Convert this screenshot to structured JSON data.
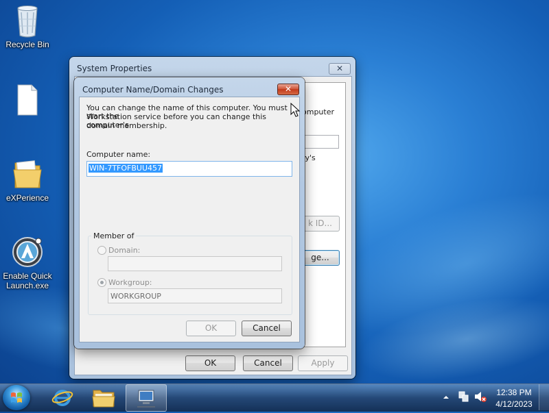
{
  "desktop": {
    "icons": [
      {
        "label": "Recycle Bin",
        "icon": "recycle-bin-icon"
      },
      {
        "label": "",
        "icon": "blank-file-icon"
      },
      {
        "label": "eXPerience",
        "icon": "folder-icon"
      },
      {
        "label": "Enable Quick Launch.exe",
        "label_line1": "Enable Quick",
        "label_line2": "Launch.exe",
        "icon": "app-exe-icon"
      }
    ]
  },
  "system_properties": {
    "title": "System Properties",
    "close_label": "✕",
    "partial_texts": {
      "computer": "omputer",
      "ys": "ry's",
      "network_id": "k ID...",
      "change": "ge..."
    },
    "buttons": {
      "ok": "OK",
      "cancel": "Cancel",
      "apply": "Apply"
    }
  },
  "dialog": {
    "title": "Computer Name/Domain Changes",
    "close_label": "✕",
    "description_line1": "You can change the name of this computer.  You must start the",
    "description_line2": "Workstation service before you can change this computer's",
    "description_line3": "domain membership.",
    "computer_name_label": "Computer name:",
    "computer_name_value": "WIN-7TFOFBUU457",
    "member_of_label": "Member of",
    "domain_label": "Domain:",
    "domain_value": "",
    "workgroup_label": "Workgroup:",
    "workgroup_value": "WORKGROUP",
    "workgroup_selected": true,
    "ok_label": "OK",
    "cancel_label": "Cancel"
  },
  "taskbar": {
    "items": [
      {
        "name": "internet-explorer",
        "icon": "internet-explorer-icon"
      },
      {
        "name": "windows-explorer",
        "icon": "folder-explorer-icon"
      },
      {
        "name": "system-properties",
        "icon": "computer-properties-icon",
        "active": true
      }
    ],
    "tray": {
      "time": "12:38 PM",
      "date": "4/12/2023",
      "icons": [
        "show-hidden-icons-icon",
        "network-icon",
        "volume-muted-icon"
      ]
    }
  },
  "colors": {
    "desktop_blue": "#1e6fc6",
    "selection": "#3399ff",
    "close_red": "#c23a1c"
  }
}
